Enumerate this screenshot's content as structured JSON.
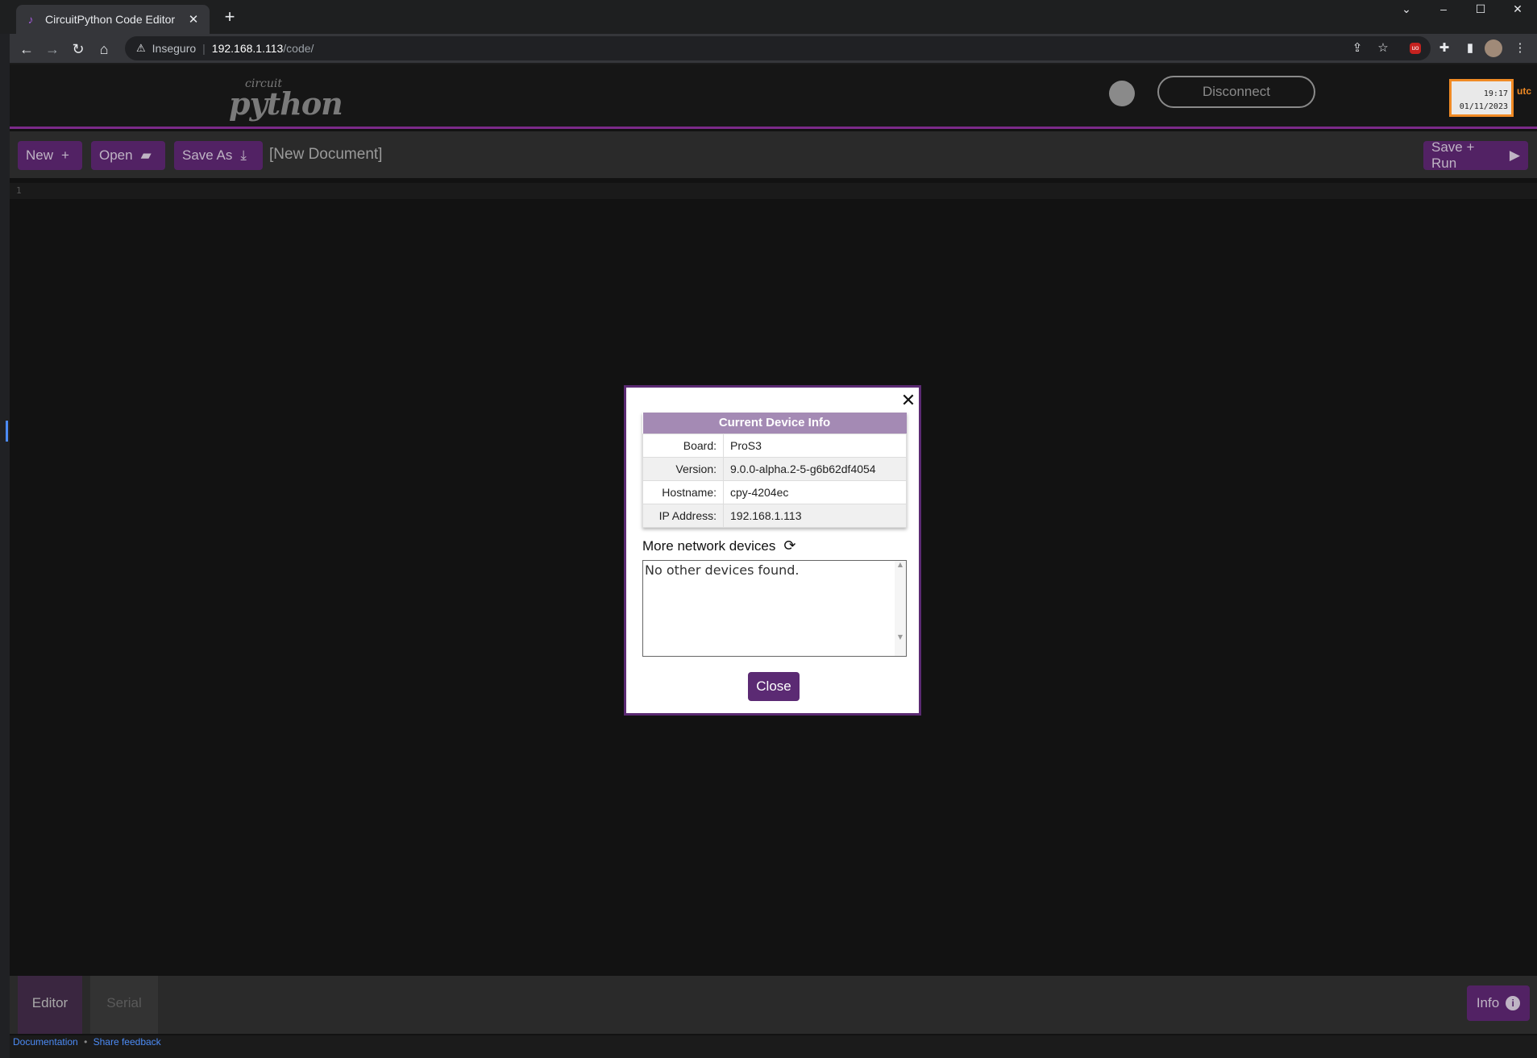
{
  "browser": {
    "tab_title": "CircuitPython Code Editor",
    "tab_close": "✕",
    "new_tab": "+",
    "address": {
      "insecure_label": "Inseguro",
      "separator": "|",
      "host": "192.168.1.113",
      "path": "/code/"
    }
  },
  "app": {
    "logo": {
      "top": "circuit",
      "main": "python"
    },
    "disconnect_label": "Disconnect",
    "clock": {
      "time": "19:17",
      "date": "01/11/2023",
      "utc_label": "utc"
    },
    "toolbar": {
      "new_label": "New",
      "open_label": "Open",
      "save_as_label": "Save As",
      "document_name": "[New Document]",
      "save_run_label": "Save + Run"
    },
    "editor": {
      "line_number": "1"
    },
    "bottom_tabs": {
      "editor": "Editor",
      "serial": "Serial",
      "info": "Info"
    },
    "footer": {
      "documentation": "Documentation",
      "separator": "•",
      "feedback": "Share feedback"
    }
  },
  "modal": {
    "table_title": "Current Device Info",
    "rows": [
      {
        "key": "Board:",
        "value": "ProS3"
      },
      {
        "key": "Version:",
        "value": "9.0.0-alpha.2-5-g6b62df4054"
      },
      {
        "key": "Hostname:",
        "value": "cpy-4204ec"
      },
      {
        "key": "IP Address:",
        "value": "192.168.1.113"
      }
    ],
    "more_devices_label": "More network devices",
    "devices_text": "No other devices found.",
    "close_label": "Close"
  },
  "colors": {
    "accent_purple": "#5b2a73",
    "header_border": "#7b2a89",
    "clock_border": "#f08a24"
  }
}
